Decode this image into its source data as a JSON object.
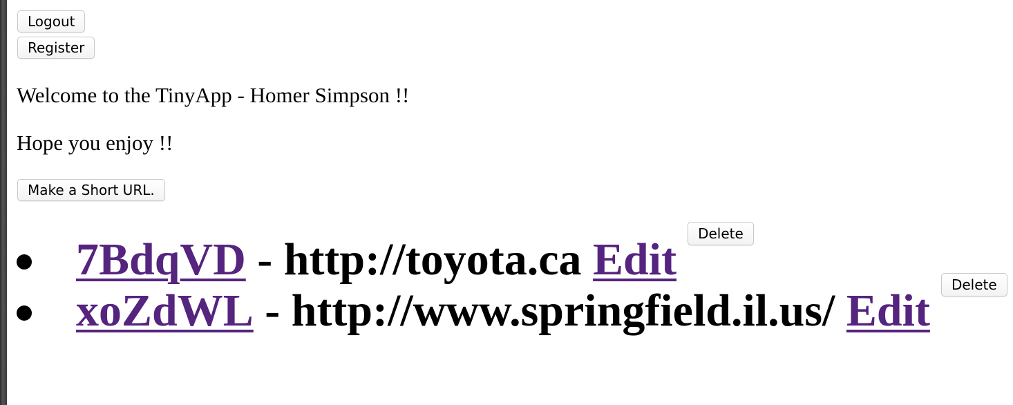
{
  "header": {
    "logout_label": "Logout",
    "register_label": "Register"
  },
  "main": {
    "welcome_text": "Welcome to the TinyApp - Homer Simpson !!",
    "enjoy_text": "Hope you enjoy !!",
    "make_short_url_label": "Make a Short URL."
  },
  "urls": [
    {
      "short": "7BdqVD",
      "separator": " - ",
      "long": "http://toyota.ca",
      "edit_label": "Edit",
      "delete_label": "Delete"
    },
    {
      "short": "xoZdWL",
      "separator": " - ",
      "long": "http://www.springfield.il.us/",
      "edit_label": "Edit",
      "delete_label": "Delete"
    }
  ],
  "colors": {
    "link": "#55247f",
    "text": "#000000",
    "background": "#ffffff"
  }
}
